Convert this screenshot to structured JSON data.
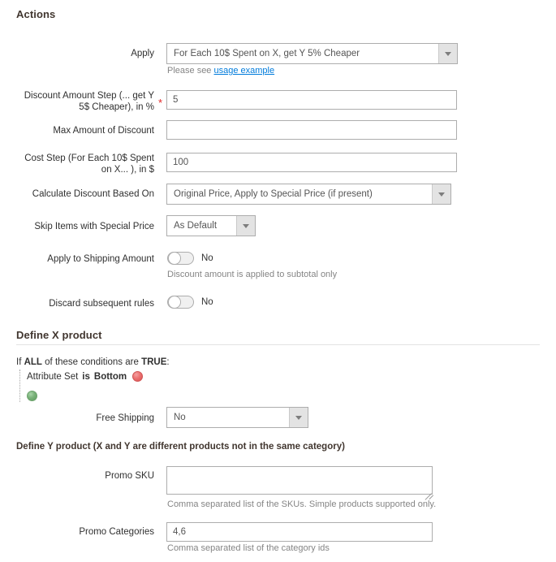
{
  "sections": {
    "actions_title": "Actions",
    "define_x_title": "Define X product",
    "define_y_title": "Define Y product (X and Y are different products not in the same category)"
  },
  "fields": {
    "apply": {
      "label": "Apply",
      "value": "For Each 10$ Spent on X, get Y 5% Cheaper",
      "note_prefix": "Please see ",
      "note_link": "usage example"
    },
    "discount_amount_step": {
      "label": "Discount Amount Step (... get Y 5$ Cheaper), in %",
      "required_mark": "*",
      "value": "5"
    },
    "max_amount_of_discount": {
      "label": "Max Amount of Discount",
      "value": ""
    },
    "cost_step": {
      "label": "Cost Step (For Each 10$ Spent on X... ), in $",
      "value": "100"
    },
    "calculate_discount_based_on": {
      "label": "Calculate Discount Based On",
      "value": "Original Price, Apply to Special Price (if present)"
    },
    "skip_items_with_special_price": {
      "label": "Skip Items with Special Price",
      "value": "As Default"
    },
    "apply_to_shipping_amount": {
      "label": "Apply to Shipping Amount",
      "state": "No",
      "note": "Discount amount is applied to subtotal only"
    },
    "discard_subsequent_rules": {
      "label": "Discard subsequent rules",
      "state": "No"
    },
    "free_shipping": {
      "label": "Free Shipping",
      "value": "No"
    },
    "promo_sku": {
      "label": "Promo SKU",
      "value": "",
      "note": "Comma separated list of the SKUs. Simple products supported only."
    },
    "promo_categories": {
      "label": "Promo Categories",
      "value": "4,6",
      "note": "Comma separated list of the category ids"
    }
  },
  "conditions": {
    "intro_if": "If",
    "intro_all": "ALL",
    "intro_mid": "of these conditions are",
    "intro_true": "TRUE",
    "intro_colon": ":",
    "rows": [
      {
        "attribute": "Attribute Set",
        "operator": "is",
        "value": "Bottom",
        "remove_icon": "remove-condition-icon"
      }
    ],
    "add_icon": "add-condition-icon"
  },
  "colors": {
    "accent_link": "#007bdb",
    "required": "#e22626",
    "remove": "#d94f4f",
    "add": "#5f9c5f",
    "border": "#adadad",
    "heading": "#41362f"
  }
}
